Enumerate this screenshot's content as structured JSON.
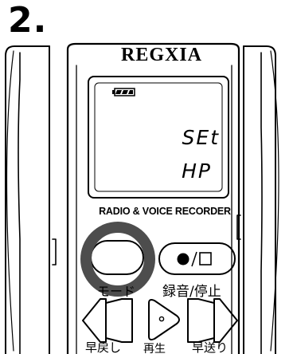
{
  "step": {
    "number": "2."
  },
  "device": {
    "brand": "REGXIA",
    "model_label": "RADIO & VOICE RECORDER",
    "display": {
      "line1": "SEt",
      "line2": "HP",
      "battery_icon": "battery-icon"
    },
    "buttons": {
      "mode": {
        "label": "モード",
        "highlighted": true
      },
      "record_stop": {
        "label": "録音/停止",
        "icon": "record-stop-icon"
      },
      "rewind": {
        "label": "早戻し",
        "icon": "rewind-icon"
      },
      "play": {
        "label": "再生",
        "icon": "play-icon"
      },
      "fast_forward": {
        "label": "早送り",
        "icon": "fast-forward-icon"
      }
    }
  },
  "colors": {
    "outline": "#000000",
    "highlight_ring": "#4d4d4d",
    "background": "#ffffff"
  }
}
